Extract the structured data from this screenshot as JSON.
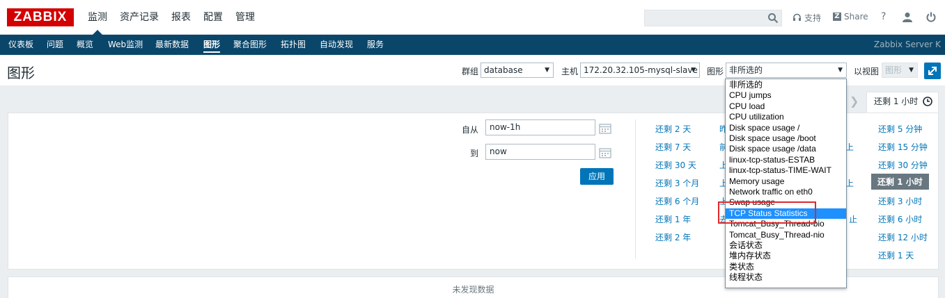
{
  "header": {
    "logo": "ZABBIX",
    "menu": [
      "监测",
      "资产记录",
      "报表",
      "配置",
      "管理"
    ],
    "active_menu": "监测",
    "search": {
      "value": "",
      "placeholder": ""
    },
    "support_label": "支持",
    "share_label": "Share",
    "help_label": "?"
  },
  "subnav": {
    "items": [
      "仪表板",
      "问题",
      "概览",
      "Web监测",
      "最新数据",
      "图形",
      "聚合图形",
      "拓扑图",
      "自动发现",
      "服务"
    ],
    "active": "图形",
    "server_name": "Zabbix Server K"
  },
  "page": {
    "title": "图形",
    "filters": {
      "group_label": "群组",
      "group_value": "database",
      "host_label": "主机",
      "host_value": "172.20.32.105-mysql-slave",
      "graph_label": "图形",
      "graph_value": "非所选的",
      "view_label": "以视图",
      "view_value": "图形"
    }
  },
  "time_tab": {
    "label": "还剩 1 小时"
  },
  "time_filter": {
    "from_label": "自从",
    "from_value": "now-1h",
    "to_label": "到",
    "to_value": "now",
    "apply_label": "应用"
  },
  "quick_ranges": {
    "col1": [
      "还剩 2 天",
      "还剩 7 天",
      "还剩 30 天",
      "还剩 3 个月",
      "还剩 6 个月",
      "还剩 1 年",
      "还剩 2 年"
    ],
    "col2_partial": [
      "昨",
      "前",
      "上",
      "上",
      "上",
      "去"
    ],
    "col3_partial": [
      "上",
      "上",
      "止"
    ],
    "col4": [
      "还剩 5 分钟",
      "还剩 15 分钟",
      "还剩 30 分钟",
      "还剩 1 小时",
      "还剩 3 小时",
      "还剩 6 小时",
      "还剩 12 小时",
      "还剩 1 天"
    ],
    "selected": "还剩 1 小时"
  },
  "no_data": "未发现数据",
  "graph_dropdown": {
    "options": [
      "非所选的",
      "CPU jumps",
      "CPU load",
      "CPU utilization",
      "Disk space usage /",
      "Disk space usage /boot",
      "Disk space usage /data",
      "linux-tcp-status-ESTAB",
      "linux-tcp-status-TIME-WAIT",
      "Memory usage",
      "Network traffic on eth0",
      "Swap usage",
      "TCP Status Statistics",
      "Tomcat_Busy_Thread-bio",
      "Tomcat_Busy_Thread-nio",
      "会话状态",
      "堆内存状态",
      "类状态",
      "线程状态"
    ],
    "highlighted": "TCP Status Statistics"
  },
  "colors": {
    "brand_red": "#d40000",
    "nav_blue": "#0a466a",
    "accent_blue": "#0275b8",
    "highlight_blue": "#1e90ff",
    "annotation_red": "#e0272b"
  }
}
